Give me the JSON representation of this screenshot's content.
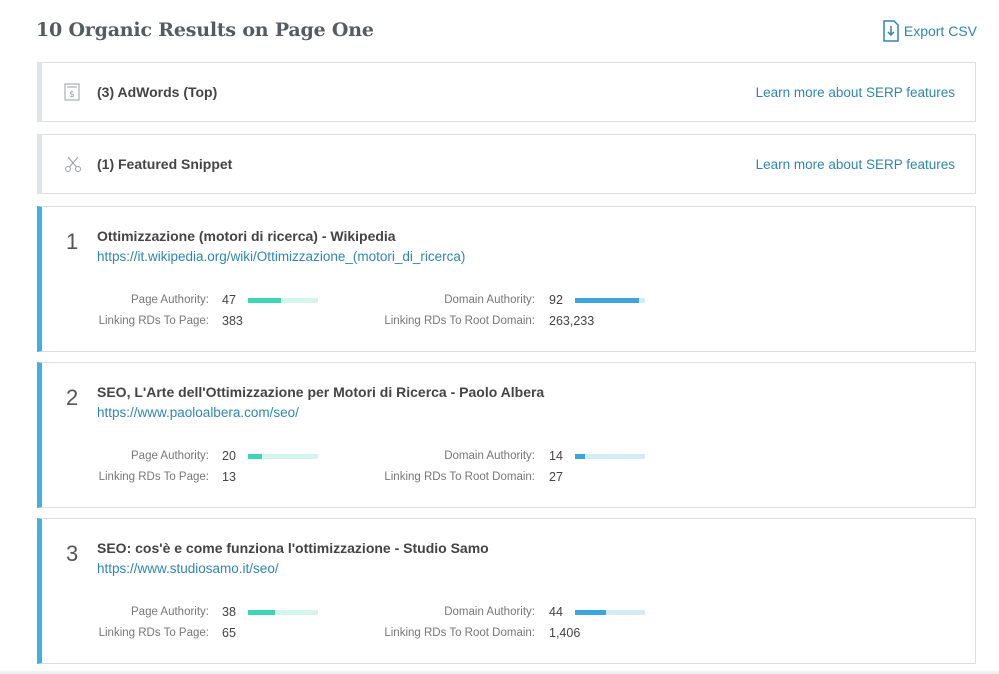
{
  "header": {
    "title": "10 Organic Results on Page One",
    "export_label": "Export CSV",
    "export_icon": "download-file-icon"
  },
  "colors": {
    "link": "#2e86b3",
    "result_accent": "#3fb0e6",
    "page_authority_bar": "#3dd6b5",
    "domain_authority_bar": "#3aa6dc"
  },
  "serp_features": [
    {
      "label": "(3) AdWords (Top)",
      "icon": "adwords-dollar-icon",
      "link": "Learn more about SERP features"
    },
    {
      "label": "(1) Featured Snippet",
      "icon": "scissors-icon",
      "link": "Learn more about SERP features"
    }
  ],
  "metric_labels": {
    "page_authority": "Page Authority:",
    "linking_rds_page": "Linking RDs To Page:",
    "domain_authority": "Domain Authority:",
    "linking_rds_root": "Linking RDs To Root Domain:"
  },
  "results": [
    {
      "rank": "1",
      "title": "Ottimizzazione (motori di ricerca) - Wikipedia",
      "url": "https://it.wikipedia.org/wiki/Ottimizzazione_(motori_di_ricerca)",
      "page_authority": "47",
      "linking_rds_page": "383",
      "domain_authority": "92",
      "linking_rds_root": "263,233"
    },
    {
      "rank": "2",
      "title": "SEO, L'Arte dell'Ottimizzazione per Motori di Ricerca - Paolo Albera",
      "url": "https://www.paoloalbera.com/seo/",
      "page_authority": "20",
      "linking_rds_page": "13",
      "domain_authority": "14",
      "linking_rds_root": "27"
    },
    {
      "rank": "3",
      "title": "SEO: cos'è e come funziona l'ottimizzazione - Studio Samo",
      "url": "https://www.studiosamo.it/seo/",
      "page_authority": "38",
      "linking_rds_page": "65",
      "domain_authority": "44",
      "linking_rds_root": "1,406"
    }
  ]
}
